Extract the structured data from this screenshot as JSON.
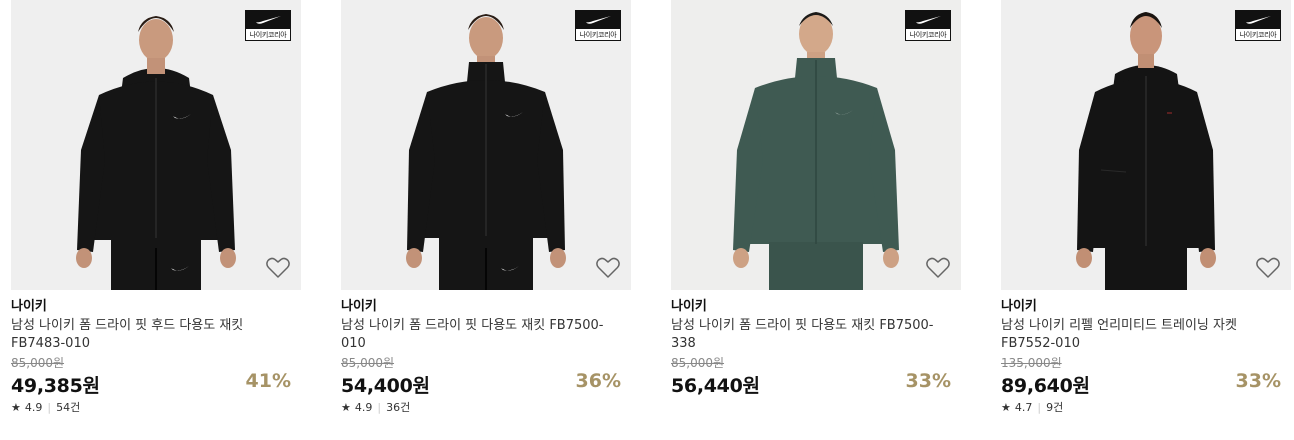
{
  "products": [
    {
      "badge_label": "나이키코리아",
      "brand": "나이키",
      "name": "남성 나이키 폼 드라이 핏 후드 다용도 재킷 FB7483-010",
      "original_price": "85,000원",
      "price": "49,385원",
      "discount": "41%",
      "rating": "4.9",
      "reviews": "54건",
      "jacket_color": "#151515",
      "variant": "hood"
    },
    {
      "badge_label": "나이키코리아",
      "brand": "나이키",
      "name": "남성 나이키 폼 드라이 핏 다용도 재킷 FB7500-010",
      "original_price": "85,000원",
      "price": "54,400원",
      "discount": "36%",
      "rating": "4.9",
      "reviews": "36건",
      "jacket_color": "#151515",
      "variant": "collar"
    },
    {
      "badge_label": "나이키코리아",
      "brand": "나이키",
      "name": "남성 나이키 폼 드라이 핏 다용도 재킷 FB7500-338",
      "original_price": "85,000원",
      "price": "56,440원",
      "discount": "33%",
      "rating": "",
      "reviews": "",
      "jacket_color": "#3f5a52",
      "variant": "collar"
    },
    {
      "badge_label": "나이키코리아",
      "brand": "나이키",
      "name": "남성 나이키 리펠 언리미티드 트레이닝 자켓 FB7552-010",
      "original_price": "135,000원",
      "price": "89,640원",
      "discount": "33%",
      "rating": "4.7",
      "reviews": "9건",
      "jacket_color": "#141414",
      "variant": "hood"
    }
  ],
  "colors": {
    "discount": "#a69366",
    "thumb_bg": "#efefef"
  },
  "icons": {
    "wishlist": "heart-outline-icon",
    "rating": "star-icon",
    "brand": "nike-swoosh-logo"
  }
}
